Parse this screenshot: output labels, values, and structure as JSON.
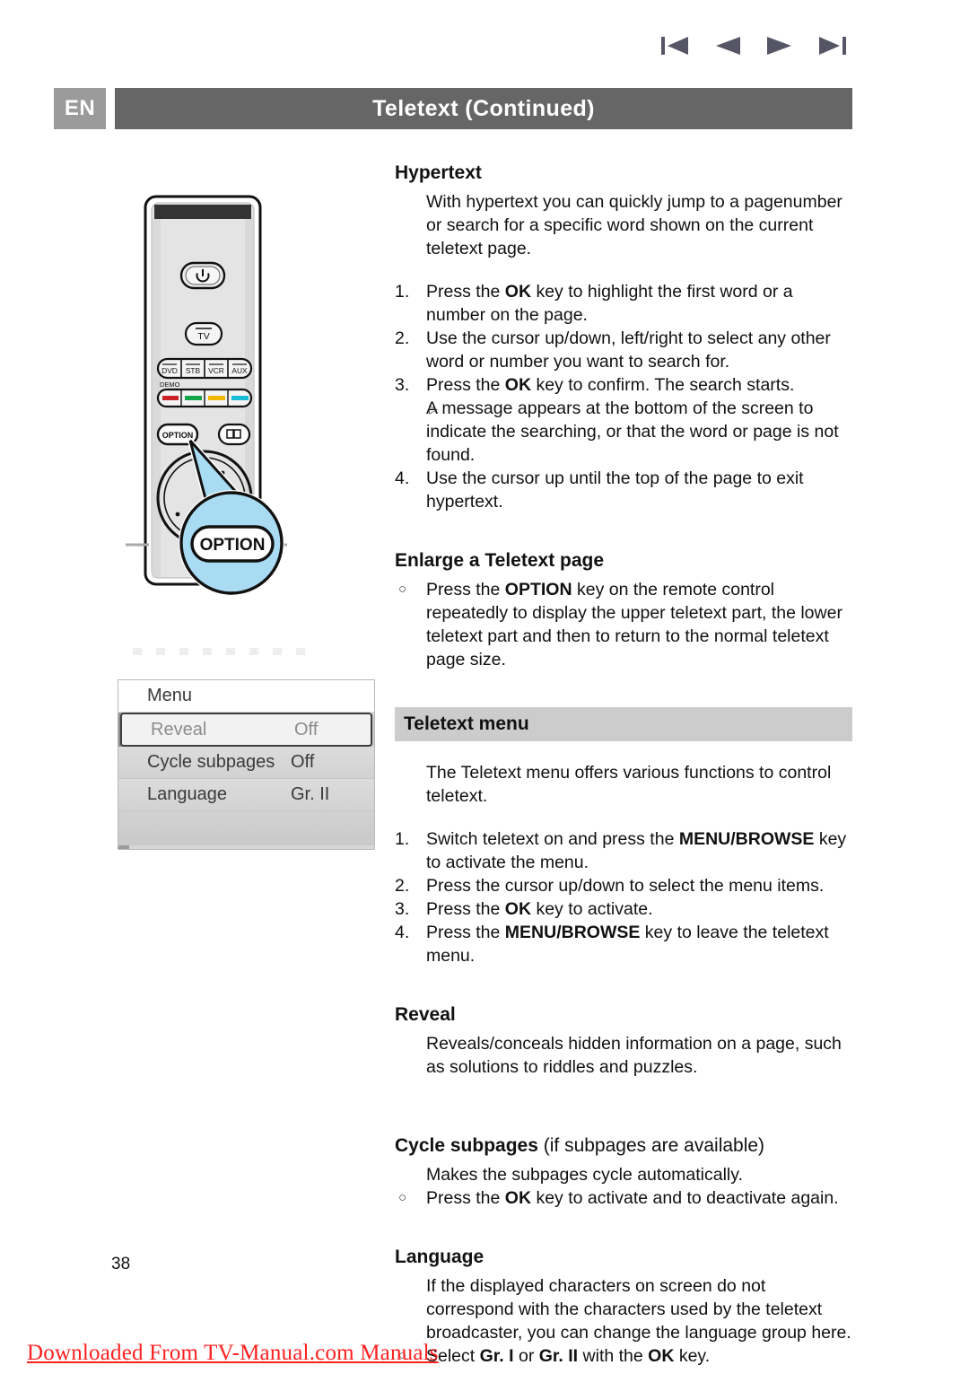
{
  "topnav": {
    "items": [
      {
        "name": "first-page-icon",
        "label": "first page"
      },
      {
        "name": "previous-page-icon",
        "label": "previous page"
      },
      {
        "name": "next-page-icon",
        "label": "next page"
      },
      {
        "name": "last-page-icon",
        "label": "last page"
      }
    ]
  },
  "header": {
    "language_badge": "EN",
    "title": "Teletext  (Continued)"
  },
  "remote": {
    "power_icon": "power-icon",
    "tv_label": "TV",
    "source_buttons": [
      "DVD",
      "STB",
      "VCR",
      "AUX"
    ],
    "demo_label": "DEMO",
    "color_keys": [
      "#cc2027",
      "#16a64a",
      "#f2b705",
      "#19bcd4"
    ],
    "option_label": "OPTION",
    "guide_icon": "book-icon",
    "callout_label": "OPTION",
    "callout_color": "#a9dcf2"
  },
  "menu_screen": {
    "title": "Menu",
    "rows": [
      {
        "label": "Reveal",
        "value": "Off",
        "selected": true
      },
      {
        "label": "Cycle subpages",
        "value": "Off",
        "selected": false
      },
      {
        "label": "Language",
        "value": "Gr. II",
        "selected": false
      }
    ]
  },
  "content": {
    "hypertext": {
      "heading": "Hypertext",
      "intro": "With hypertext you can quickly jump to a pagenumber or search for a specific word shown on the current teletext page.",
      "steps": [
        {
          "num": "1.",
          "pre": "Press the ",
          "key": "OK",
          "post": " key to highlight the first word or a number on the page."
        },
        {
          "num": "2.",
          "pre": "Use the cursor up/down, left/right to select any other word or number you want to search for.",
          "key": "",
          "post": ""
        },
        {
          "num": "3.",
          "pre": "Press the ",
          "key": "OK",
          "post": " key to confirm. The search starts."
        },
        {
          "num": "4.",
          "pre": "Use the cursor up until the top of the page to exit hypertext.",
          "key": "",
          "post": ""
        }
      ],
      "sub_bullet": "A message appears at the bottom of the screen to indicate the searching, or that the word or page is not found.",
      "sub_bullet_mark": "▷"
    },
    "enlarge": {
      "heading": "Enlarge a Teletext page",
      "bullet_mark": "○",
      "bullet_pre": "Press the ",
      "bullet_key": "OPTION",
      "bullet_post": " key on the remote control repeatedly to display the upper teletext part, the lower teletext part and then to return to the normal teletext page size."
    },
    "teletext_menu": {
      "band_title": "Teletext menu",
      "intro": "The Teletext menu offers various functions to control teletext.",
      "steps": [
        {
          "num": "1.",
          "pre": "Switch teletext on and press the ",
          "key": "MENU/BROWSE",
          "post": " key to activate the menu."
        },
        {
          "num": "2.",
          "pre": "Press the cursor up/down to select the menu items.",
          "key": "",
          "post": ""
        },
        {
          "num": "3.",
          "pre": "Press the ",
          "key": "OK",
          "post": " key to activate."
        },
        {
          "num": "4.",
          "pre": "Press the ",
          "key": "MENU/BROWSE",
          "post": " key to leave the teletext menu."
        }
      ]
    },
    "reveal": {
      "heading": "Reveal",
      "body": "Reveals/conceals hidden information on a page, such as solutions to riddles and puzzles."
    },
    "cycle": {
      "heading_bold": "Cycle subpages",
      "heading_rest": " (if subpages are available)",
      "body": "Makes the subpages cycle automatically.",
      "bullet_mark": "○",
      "bullet_pre": "Press the ",
      "bullet_key": "OK",
      "bullet_post": " key to activate and to deactivate again."
    },
    "language": {
      "heading": "Language",
      "body": "If the displayed characters on screen do not correspond with the characters used by the teletext broadcaster, you can change the language group here.",
      "bullet_mark": "○",
      "bullet_p1": "Select ",
      "bullet_k1": "Gr. I",
      "bullet_p2": " or ",
      "bullet_k2": "Gr. II",
      "bullet_p3": " with the ",
      "bullet_k3": "OK",
      "bullet_p4": " key."
    }
  },
  "page_number": "38",
  "footer": "Downloaded From TV-Manual.com Manuals"
}
